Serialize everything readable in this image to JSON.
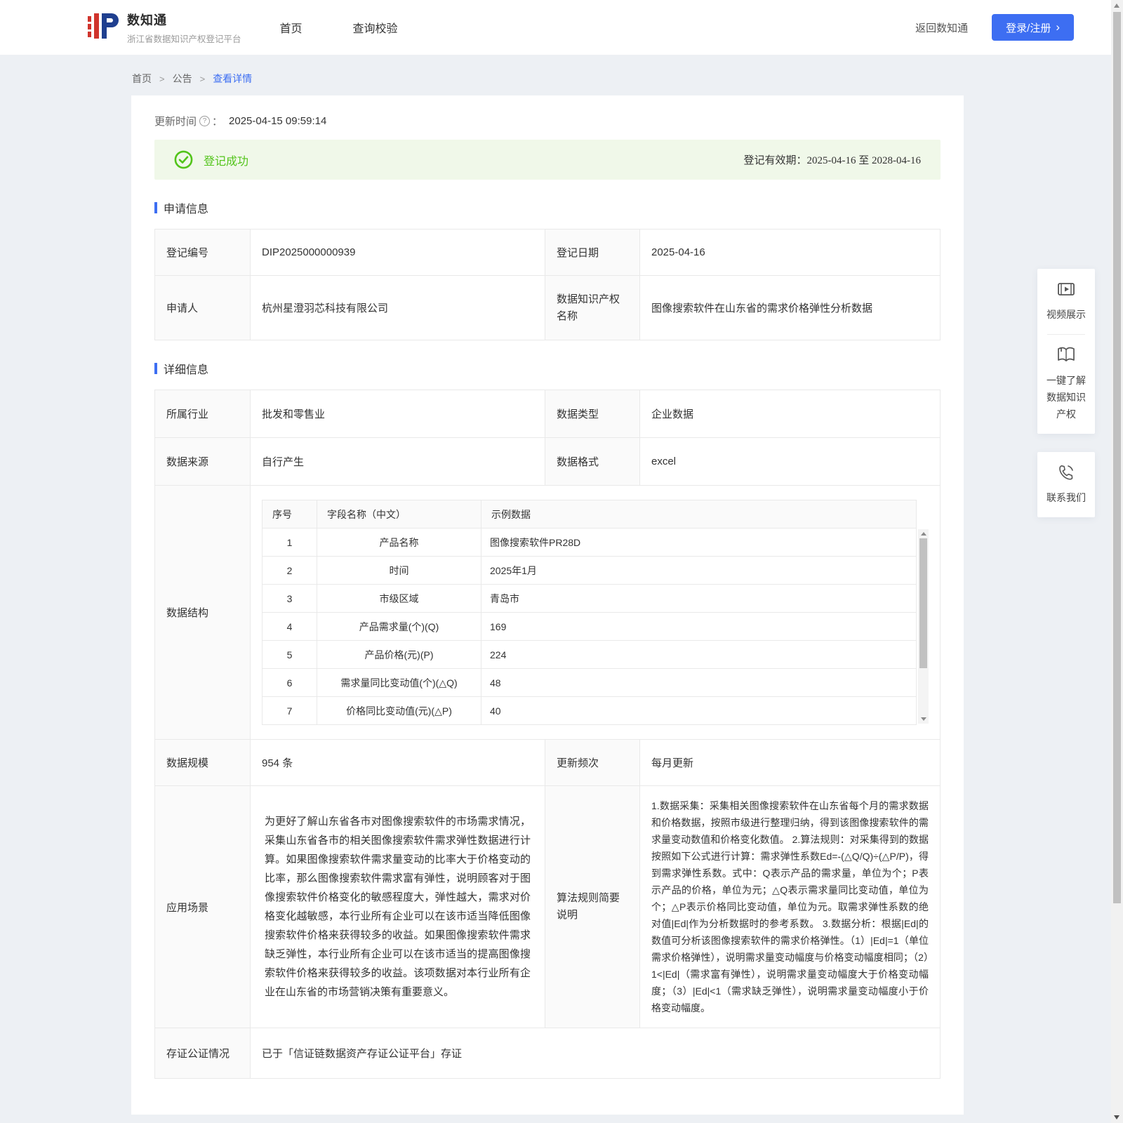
{
  "header": {
    "logo_title": "数知通",
    "logo_subtitle": "浙江省数据知识产权登记平台",
    "nav": {
      "home": "首页",
      "verify": "查询校验"
    },
    "back_link": "返回数知通",
    "login_button": "登录/注册",
    "login_chevron": "›",
    "accent_color": "#3D6EF2"
  },
  "breadcrumb": {
    "home": "首页",
    "announcement": "公告",
    "detail": "查看详情",
    "separator": ">"
  },
  "meta": {
    "update_time_label": "更新时间",
    "help_glyph": "?",
    "colon": "：",
    "update_time": "2025-04-15 09:59:14"
  },
  "banner": {
    "status": "登记成功",
    "validity_label": "登记有效期：",
    "validity": "2025-04-16 至 2028-04-16",
    "status_color": "#52c41a"
  },
  "application_info": {
    "title": "申请信息",
    "reg_no_label": "登记编号",
    "reg_no": "DIP2025000000939",
    "reg_date_label": "登记日期",
    "reg_date": "2025-04-16",
    "applicant_label": "申请人",
    "applicant": "杭州星澄羽芯科技有限公司",
    "ip_name_label": "数据知识产权名称",
    "ip_name": "图像搜索软件在山东省的需求价格弹性分析数据"
  },
  "detail_info": {
    "title": "详细信息",
    "industry_label": "所属行业",
    "industry": "批发和零售业",
    "data_type_label": "数据类型",
    "data_type": "企业数据",
    "source_label": "数据来源",
    "source": "自行产生",
    "format_label": "数据格式",
    "format": "excel",
    "data_structure": {
      "label": "数据结构",
      "columns": [
        "序号",
        "字段名称（中文）",
        "示例数据"
      ],
      "rows": [
        [
          "1",
          "产品名称",
          "图像搜索软件PR28D"
        ],
        [
          "2",
          "时间",
          "2025年1月"
        ],
        [
          "3",
          "市级区域",
          "青岛市"
        ],
        [
          "4",
          "产品需求量(个)(Q)",
          "169"
        ],
        [
          "5",
          "产品价格(元)(P)",
          "224"
        ],
        [
          "6",
          "需求量同比变动值(个)(△Q)",
          "48"
        ],
        [
          "7",
          "价格同比变动值(元)(△P)",
          "40"
        ]
      ]
    },
    "scale_label": "数据规模",
    "scale": "954 条",
    "frequency_label": "更新频次",
    "frequency": "每月更新",
    "scenario_label": "应用场景",
    "scenario_text": "为更好了解山东省各市对图像搜索软件的市场需求情况，采集山东省各市的相关图像搜索软件需求弹性数据进行计算。如果图像搜索软件需求量变动的比率大于价格变动的比率，那么图像搜索软件需求富有弹性，说明顾客对于图像搜索软件价格变化的敏感程度大，弹性越大，需求对价格变化越敏感，本行业所有企业可以在该市适当降低图像搜索软件价格来获得较多的收益。如果图像搜索软件需求缺乏弹性，本行业所有企业可以在该市适当的提高图像搜索软件价格来获得较多的收益。该项数据对本行业所有企业在山东省的市场营销决策有重要意义。",
    "algorithm_label": "算法规则简要说明",
    "algorithm_text": "1.数据采集：采集相关图像搜索软件在山东省每个月的需求数据和价格数据，按照市级进行整理归纳，得到该图像搜索软件的需求量变动数值和价格变化数值。 2.算法规则：对采集得到的数据按照如下公式进行计算：需求弹性系数Ed=-(△Q/Q)÷(△P/P)，得到需求弹性系数。式中：Q表示产品的需求量，单位为个；P表示产品的价格，单位为元；△Q表示需求量同比变动值，单位为个；△P表示价格同比变动值，单位为元。取需求弹性系数的绝对值|Ed|作为分析数据时的参考系数。 3.数据分析：根据|Ed|的数值可分析该图像搜索软件的需求价格弹性。（1）|Ed|=1（单位需求价格弹性），说明需求量变动幅度与价格变动幅度相同；（2）1<|Ed|（需求富有弹性），说明需求量变动幅度大于价格变动幅度；（3）|Ed|<1（需求缺乏弹性），说明需求量变动幅度小于价格变动幅度。",
    "notary_label": "存证公证情况",
    "notary": "已于「信证链数据资产存证公证平台」存证"
  },
  "floating_panel": {
    "video_label": "视频展示",
    "learn_label": "一键了解数据知识产权",
    "contact_label": "联系我们"
  }
}
